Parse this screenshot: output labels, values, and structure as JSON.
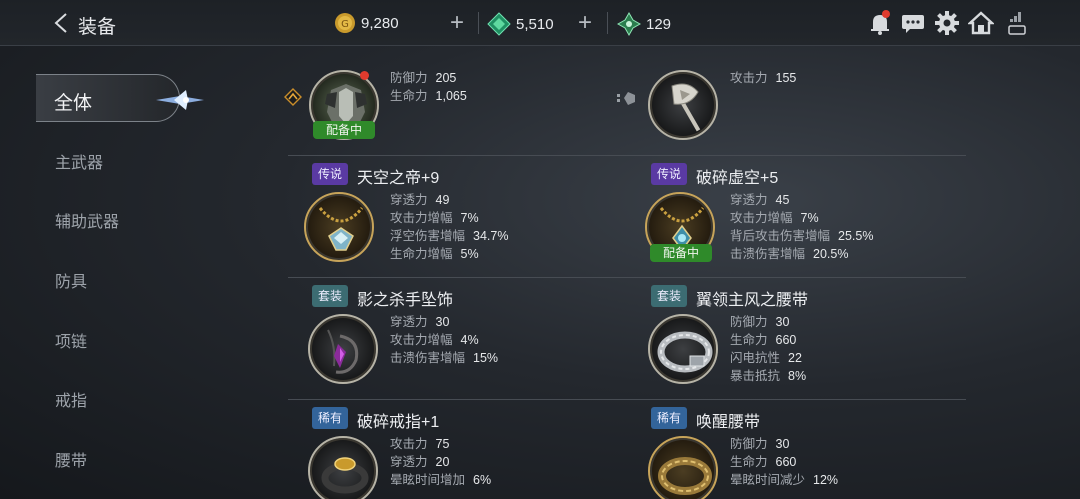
{
  "header": {
    "title": "装备",
    "gold": "9,280",
    "gem": "5,510",
    "crystal": "129"
  },
  "sidebar": {
    "items": [
      {
        "label": "全体"
      },
      {
        "label": "主武器"
      },
      {
        "label": "辅助武器"
      },
      {
        "label": "防具"
      },
      {
        "label": "项链"
      },
      {
        "label": "戒指"
      },
      {
        "label": "腰带"
      }
    ]
  },
  "equipped_tag": "配备中",
  "top": {
    "armor": {
      "stats": [
        {
          "k": "防御力",
          "v": "205"
        },
        {
          "k": "生命力",
          "v": "1,065"
        }
      ]
    },
    "weapon": {
      "stats": [
        {
          "k": "攻击力",
          "v": "155"
        }
      ]
    }
  },
  "items": [
    {
      "grade": "传说",
      "name": "天空之帝+9",
      "stats": [
        {
          "k": "穿透力",
          "v": "49"
        },
        {
          "k": "攻击力增幅",
          "v": "7%"
        },
        {
          "k": "浮空伤害增幅",
          "v": "34.7%"
        },
        {
          "k": "生命力增幅",
          "v": "5%"
        }
      ]
    },
    {
      "grade": "传说",
      "name": "破碎虚空+5",
      "stats": [
        {
          "k": "穿透力",
          "v": "45"
        },
        {
          "k": "攻击力增幅",
          "v": "7%"
        },
        {
          "k": "背后攻击伤害增幅",
          "v": "25.5%"
        },
        {
          "k": "击溃伤害增幅",
          "v": "20.5%"
        }
      ]
    },
    {
      "grade": "套装",
      "name": "影之杀手坠饰",
      "stats": [
        {
          "k": "穿透力",
          "v": "30"
        },
        {
          "k": "攻击力增幅",
          "v": "4%"
        },
        {
          "k": "击溃伤害增幅",
          "v": "15%"
        }
      ]
    },
    {
      "grade": "套装",
      "name": "翼领主风之腰带",
      "stats": [
        {
          "k": "防御力",
          "v": "30"
        },
        {
          "k": "生命力",
          "v": "660"
        },
        {
          "k": "闪电抗性",
          "v": "22"
        },
        {
          "k": "暴击抵抗",
          "v": "8%"
        }
      ]
    },
    {
      "grade": "稀有",
      "name": "破碎戒指+1",
      "stats": [
        {
          "k": "攻击力",
          "v": "75"
        },
        {
          "k": "穿透力",
          "v": "20"
        },
        {
          "k": "晕眩时间增加",
          "v": "6%"
        }
      ]
    },
    {
      "grade": "稀有",
      "name": "唤醒腰带",
      "stats": [
        {
          "k": "防御力",
          "v": "30"
        },
        {
          "k": "生命力",
          "v": "660"
        },
        {
          "k": "晕眩时间减少",
          "v": "12%"
        }
      ]
    }
  ],
  "colors": {
    "accent_green": "#2f8a2a",
    "legend": "#5a3aa3",
    "set": "#3c6c72",
    "rare": "#33649a",
    "alert": "#e03b2e"
  }
}
